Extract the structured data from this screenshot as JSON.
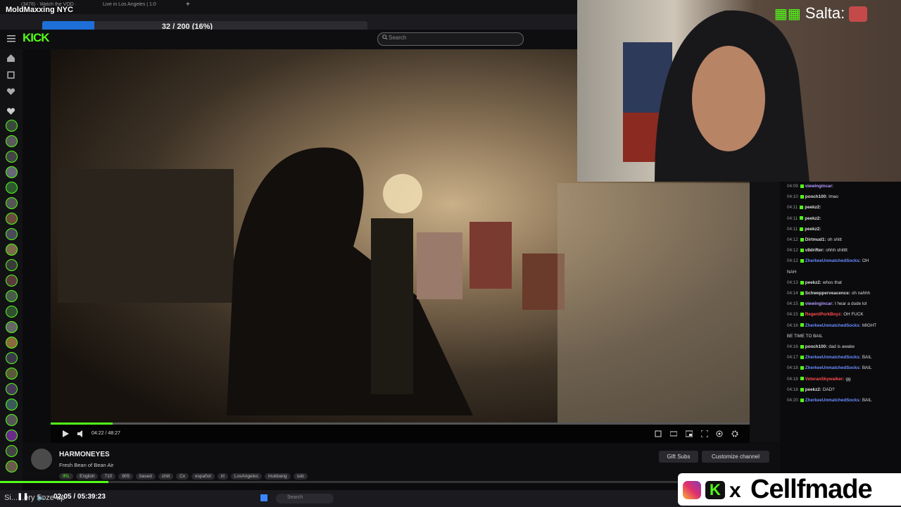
{
  "app_title": "MoldMaxxing NYC",
  "browser": {
    "tabs": [
      "(3478) · Watch the VOD ·",
      "Live in Los Angeles | 1:0"
    ],
    "new_tab": "+"
  },
  "progress": {
    "text": "32 / 200 (16%)",
    "fraction": 0.16
  },
  "kick": {
    "logo": "KICK",
    "search_placeholder": "Search"
  },
  "player": {
    "time": "04:22 / 48:27",
    "seek_fraction": 0.09
  },
  "webcam_overlay": {
    "label": "Salta:"
  },
  "chat": [
    {
      "time": "04:09",
      "user": "viewingincar:",
      "text": "",
      "color": "#b49cff"
    },
    {
      "time": "04:10",
      "user": "pooch100:",
      "text": "lmao",
      "color": "#dddddd"
    },
    {
      "time": "04:11",
      "user": "peekz2:",
      "text": "",
      "color": "#dddddd"
    },
    {
      "time": "04:11",
      "user": "peekz2:",
      "text": "",
      "color": "#dddddd"
    },
    {
      "time": "04:11",
      "user": "peekz2:",
      "text": "",
      "color": "#dddddd"
    },
    {
      "time": "04:12",
      "user": "Dirtmud1:",
      "text": "oh shitt",
      "color": "#dddddd"
    },
    {
      "time": "04:12",
      "user": "v8drifter:",
      "text": "ohhh shitttt",
      "color": "#dddddd"
    },
    {
      "time": "04:12",
      "user": "ZherkeeUnmatchedSocks:",
      "text": "OH",
      "color": "#6b8cff"
    },
    {
      "time": "",
      "user": "",
      "text": "NAH",
      "color": "#dddddd"
    },
    {
      "time": "04:13",
      "user": "peekz2:",
      "text": "whos that",
      "color": "#dddddd"
    },
    {
      "time": "04:14",
      "user": "Schwepperveacence:",
      "text": "oh nahhh",
      "color": "#dddddd"
    },
    {
      "time": "04:15",
      "user": "viewingincar:",
      "text": "I hear a dude lol",
      "color": "#b49cff"
    },
    {
      "time": "04:15",
      "user": "RegentPorkBoyz:",
      "text": "OH FUCK",
      "color": "#ff4d4d"
    },
    {
      "time": "04:16",
      "user": "ZherkeeUnmatchedSocks:",
      "text": "MIGHT",
      "color": "#6b8cff"
    },
    {
      "time": "",
      "user": "",
      "text": "BE TIME TO BAIL",
      "color": "#dddddd"
    },
    {
      "time": "04:16",
      "user": "pooch100:",
      "text": "dad is awake",
      "color": "#dddddd"
    },
    {
      "time": "04:17",
      "user": "ZherkeeUnmatchedSocks:",
      "text": "BAIL",
      "color": "#6b8cff"
    },
    {
      "time": "04:18",
      "user": "ZherkeeUnmatchedSocks:",
      "text": "BAIL",
      "color": "#6b8cff"
    },
    {
      "time": "04:18",
      "user": "VeteranSkywalker:",
      "text": "gg",
      "color": "#ff4d4d"
    },
    {
      "time": "04:18",
      "user": "peekz2:",
      "text": "DAD?",
      "color": "#dddddd"
    },
    {
      "time": "04:20",
      "user": "ZherkeeUnmatchedSocks:",
      "text": "BAIL",
      "color": "#6b8cff"
    }
  ],
  "streamer": {
    "name": "HARMONEYES",
    "title": "Fresh Bean of Bean Air",
    "tags": [
      "IRL",
      "English",
      "710",
      "805",
      "based",
      "chill",
      "Cx",
      "español",
      "irl",
      "LosAngeles",
      "mukbang",
      "ssb"
    ]
  },
  "buttons": {
    "gift_subs": "Gift Subs",
    "customize": "Customize channel"
  },
  "outer_player": {
    "time": "02:05 / 05:39:23",
    "subtitle": "Si... ..ery froze up",
    "seek_fraction": 0.12
  },
  "taskbar": {
    "search_placeholder": "Search"
  },
  "watermark": {
    "handle": "Cellfmade"
  },
  "colors": {
    "kick_green": "#53fc18",
    "accent_blue": "#1e6fd8"
  }
}
